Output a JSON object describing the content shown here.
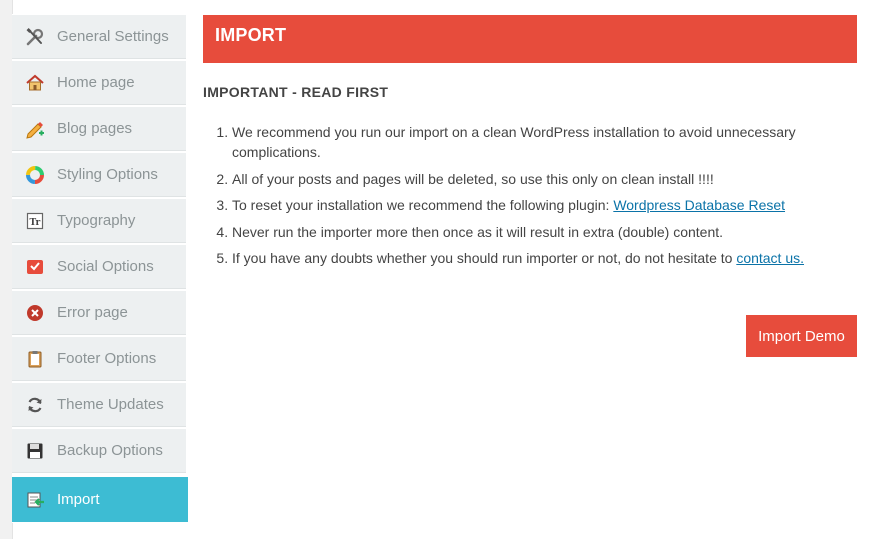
{
  "sidebar": {
    "items": [
      {
        "label": "General Settings",
        "icon": "tools-icon"
      },
      {
        "label": "Home page",
        "icon": "home-icon"
      },
      {
        "label": "Blog pages",
        "icon": "pencil-icon"
      },
      {
        "label": "Styling Options",
        "icon": "color-wheel-icon"
      },
      {
        "label": "Typography",
        "icon": "typography-icon"
      },
      {
        "label": "Social Options",
        "icon": "social-icon"
      },
      {
        "label": "Error page",
        "icon": "error-icon"
      },
      {
        "label": "Footer Options",
        "icon": "clipboard-icon"
      },
      {
        "label": "Theme Updates",
        "icon": "refresh-icon"
      },
      {
        "label": "Backup Options",
        "icon": "save-icon"
      },
      {
        "label": "Import",
        "icon": "import-icon",
        "active": true
      }
    ]
  },
  "colors": {
    "header_bg": "#e74c3c",
    "active_bg": "#3dbcd3",
    "link": "#0b73a8"
  },
  "main": {
    "title": "IMPORT",
    "subheading": "IMPORTANT - READ FIRST",
    "instructions": {
      "item1": "We recommend you run our import on a clean WordPress installation to avoid unnecessary complications.",
      "item2": "All of your posts and pages will be deleted, so use this only on clean install !!!!",
      "item3_text": "To reset your installation we recommend the following plugin: ",
      "item3_link": "Wordpress Database Reset",
      "item4": "Never run the importer more then once as it will result in extra (double) content.",
      "item5_text": "If you have any doubts whether you should run importer or not, do not hesitate to ",
      "item5_link": "contact us."
    },
    "import_button": "Import Demo"
  }
}
